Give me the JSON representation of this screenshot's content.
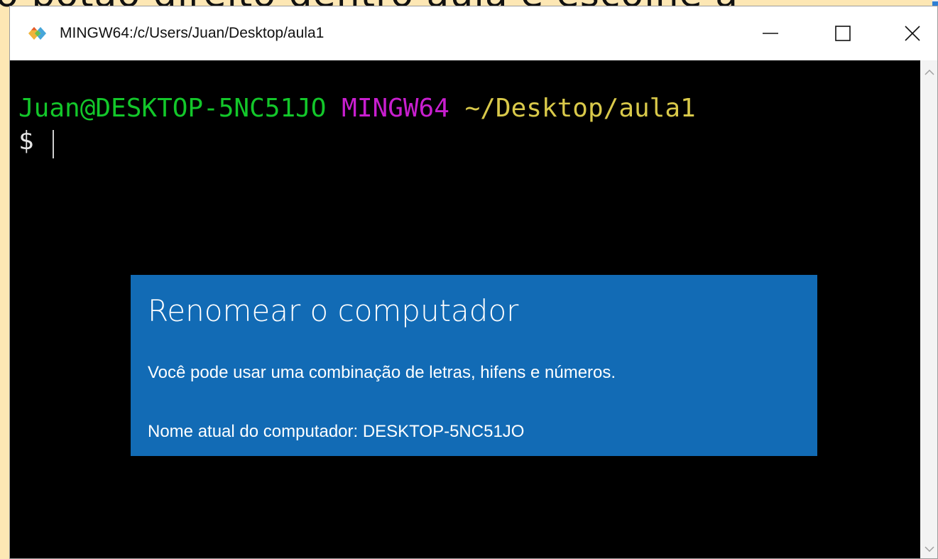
{
  "background": {
    "slide_text": "o botão direito dentro aula e escolhe a"
  },
  "window": {
    "title": "MINGW64:/c/Users/Juan/Desktop/aula1",
    "controls": {
      "minimize": "minimize-icon",
      "maximize": "maximize-icon",
      "close": "close-icon"
    }
  },
  "terminal": {
    "prompt": {
      "user": "Juan@DESKTOP-5NC51JO",
      "host": "MINGW64",
      "path": "~/Desktop/aula1",
      "symbol": "$"
    },
    "colors": {
      "user": "#13c72a",
      "host": "#c81fcf",
      "path": "#d9c94a",
      "background": "#000000"
    }
  },
  "rename_dialog": {
    "title": "Renomear o computador",
    "description": "Você pode usar uma combinação de letras, hifens e números.",
    "current_name": "Nome atual do computador: DESKTOP-5NC51JO",
    "color": "#126bb5"
  }
}
